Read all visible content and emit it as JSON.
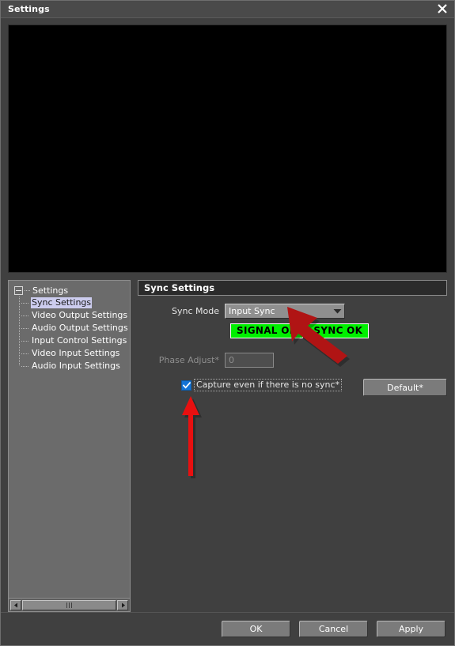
{
  "window": {
    "title": "Settings",
    "close_icon": "close-x-icon"
  },
  "preview": {
    "label": "video-preview",
    "background_color": "#000000"
  },
  "tree": {
    "root_label": "Settings",
    "items": [
      {
        "label": "Sync Settings",
        "selected": true
      },
      {
        "label": "Video Output Settings",
        "selected": false
      },
      {
        "label": "Audio Output Settings",
        "selected": false
      },
      {
        "label": "Input Control Settings",
        "selected": false
      },
      {
        "label": "Video Input Settings",
        "selected": false
      },
      {
        "label": "Audio Input Settings",
        "selected": false
      }
    ],
    "scrollbar": {
      "left_arrow_icon": "arrow-left-icon",
      "right_arrow_icon": "arrow-right-icon",
      "thumb_grip_icon": "grip-icon"
    }
  },
  "panel": {
    "group_title": "Sync Settings",
    "sync_mode": {
      "label": "Sync Mode",
      "value": "Input Sync",
      "dropdown_icon": "chevron-down-icon"
    },
    "status": {
      "signal_label": "SIGNAL OK",
      "sync_label": "SYNC OK",
      "color": "#00ef00",
      "text_color": "#000000"
    },
    "phase_adjust": {
      "label": "Phase Adjust*",
      "value": "0",
      "disabled": true
    },
    "capture_checkbox": {
      "label": "Capture even if there is no sync*",
      "checked": true
    },
    "default_button": "Default*"
  },
  "footer": {
    "ok": "OK",
    "cancel": "Cancel",
    "apply": "Apply"
  },
  "annotations": {
    "arrow_diagonal_color": "#b01414",
    "arrow_up_color": "#e81010"
  }
}
